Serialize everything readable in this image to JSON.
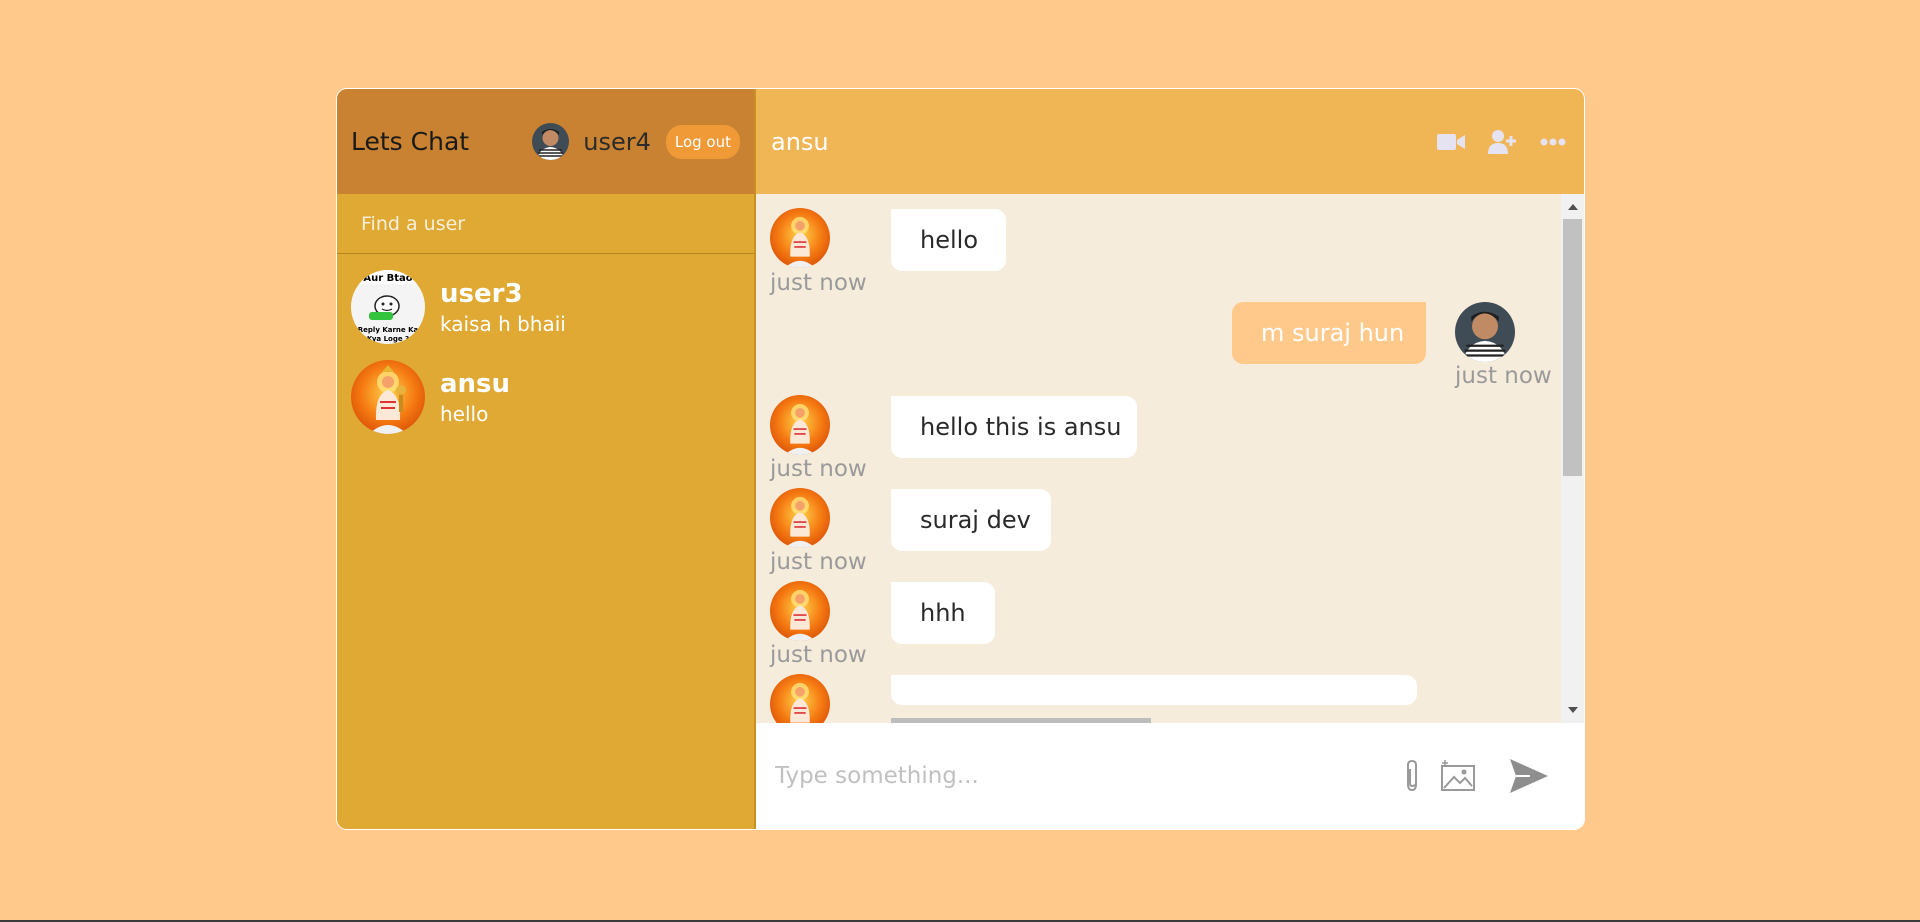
{
  "app": {
    "logo": "Lets Chat"
  },
  "current_user": {
    "name": "user4",
    "logout_label": "Log out"
  },
  "search": {
    "placeholder": "Find a user"
  },
  "chats": [
    {
      "name": "user3",
      "last_message": "kaisa h bhaii",
      "avatar": "meme-avatar"
    },
    {
      "name": "ansu",
      "last_message": "hello",
      "avatar": "deity-avatar"
    }
  ],
  "chat": {
    "title": "ansu",
    "icons": [
      "video-call-icon",
      "add-user-icon",
      "more-options-icon"
    ]
  },
  "messages": [
    {
      "text": "hello",
      "time": "just now",
      "own": false
    },
    {
      "text": "m suraj hun",
      "time": "just now",
      "own": true
    },
    {
      "text": "hello this is ansu",
      "time": "just now",
      "own": false
    },
    {
      "text": "suraj dev",
      "time": "just now",
      "own": false
    },
    {
      "text": "hhh",
      "time": "just now",
      "own": false
    },
    {
      "text": "",
      "time": "",
      "own": false
    }
  ],
  "composer": {
    "placeholder": "Type something..."
  },
  "colors": {
    "background": "#ffc98b",
    "sidebar": "#dfa933",
    "sidebar_header": "#c98231",
    "chat_header": "#f0b555",
    "chat_area": "#f6ecdc",
    "logout_button": "#f09a37"
  }
}
